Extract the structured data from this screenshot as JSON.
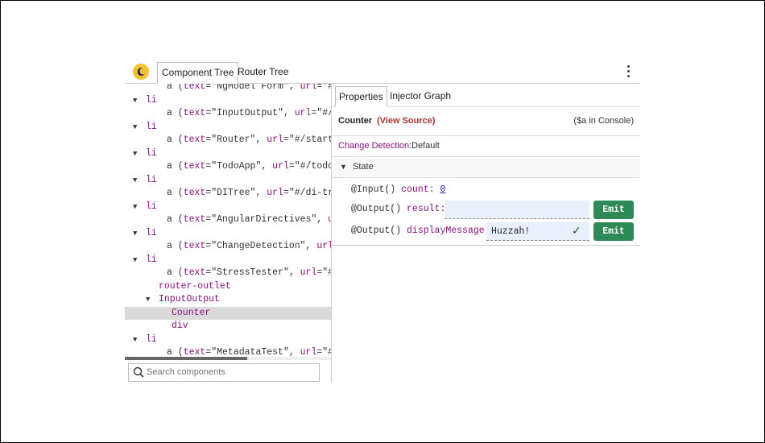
{
  "header": {
    "tabs": [
      "Component Tree",
      "Router Tree"
    ],
    "icons": {
      "logo": "angular-devtools-moon-icon",
      "menu": "kebab-menu-icon"
    },
    "accent_color": "#f5c22f"
  },
  "tree": {
    "rows": [
      {
        "tri": "",
        "parts": [
          [
            "txt",
            "a ("
          ],
          [
            "tag",
            "text"
          ],
          [
            "txt",
            "=\"NgModel Form\", "
          ],
          [
            "tag",
            "url"
          ],
          [
            "txt",
            "=\"#"
          ]
        ]
      },
      {
        "tri": "▼",
        "parts": [
          [
            "tag",
            "li"
          ]
        ]
      },
      {
        "tri": "",
        "parts": [
          [
            "txt",
            "a ("
          ],
          [
            "tag",
            "text"
          ],
          [
            "txt",
            "=\"InputOutput\", "
          ],
          [
            "tag",
            "url"
          ],
          [
            "txt",
            "=\"#/"
          ]
        ]
      },
      {
        "tri": "▼",
        "parts": [
          [
            "tag",
            "li"
          ]
        ]
      },
      {
        "tri": "",
        "parts": [
          [
            "txt",
            "a ("
          ],
          [
            "tag",
            "text"
          ],
          [
            "txt",
            "=\"Router\", "
          ],
          [
            "tag",
            "url"
          ],
          [
            "txt",
            "=\"#/start"
          ]
        ]
      },
      {
        "tri": "▼",
        "parts": [
          [
            "tag",
            "li"
          ]
        ]
      },
      {
        "tri": "",
        "parts": [
          [
            "txt",
            "a ("
          ],
          [
            "tag",
            "text"
          ],
          [
            "txt",
            "=\"TodoApp\", "
          ],
          [
            "tag",
            "url"
          ],
          [
            "txt",
            "=\"#/todo"
          ]
        ]
      },
      {
        "tri": "▼",
        "parts": [
          [
            "tag",
            "li"
          ]
        ]
      },
      {
        "tri": "",
        "parts": [
          [
            "txt",
            "a ("
          ],
          [
            "tag",
            "text"
          ],
          [
            "txt",
            "=\"DITree\", "
          ],
          [
            "tag",
            "url"
          ],
          [
            "txt",
            "=\"#/di-tr"
          ]
        ]
      },
      {
        "tri": "▼",
        "parts": [
          [
            "tag",
            "li"
          ]
        ]
      },
      {
        "tri": "",
        "parts": [
          [
            "txt",
            "a ("
          ],
          [
            "tag",
            "text"
          ],
          [
            "txt",
            "=\"AngularDirectives\", "
          ],
          [
            "tag",
            "u"
          ],
          [
            "txt",
            ""
          ]
        ]
      },
      {
        "tri": "▼",
        "parts": [
          [
            "tag",
            "li"
          ]
        ]
      },
      {
        "tri": "",
        "parts": [
          [
            "txt",
            "a ("
          ],
          [
            "tag",
            "text"
          ],
          [
            "txt",
            "=\"ChangeDetection\", "
          ],
          [
            "tag",
            "url"
          ],
          [
            "txt",
            ""
          ]
        ]
      },
      {
        "tri": "▼",
        "parts": [
          [
            "tag",
            "li"
          ]
        ]
      },
      {
        "tri": "",
        "parts": [
          [
            "txt",
            "a ("
          ],
          [
            "tag",
            "text"
          ],
          [
            "txt",
            "=\"StressTester\", "
          ],
          [
            "tag",
            "url"
          ],
          [
            "txt",
            "=\"#"
          ]
        ]
      },
      {
        "tri": "",
        "parts": [
          [
            "tag",
            "router-outlet"
          ]
        ]
      },
      {
        "tri": "▼",
        "parts": [
          [
            "tag",
            "InputOutput"
          ]
        ]
      },
      {
        "tri": "",
        "parts": [
          [
            "tag",
            "Counter"
          ]
        ]
      },
      {
        "tri": "",
        "parts": [
          [
            "tag",
            "div"
          ]
        ]
      },
      {
        "tri": "▼",
        "parts": [
          [
            "tag",
            "li"
          ]
        ]
      },
      {
        "tri": "",
        "parts": [
          [
            "txt",
            "a ("
          ],
          [
            "tag",
            "text"
          ],
          [
            "txt",
            "=\"MetadataTest\", "
          ],
          [
            "tag",
            "url"
          ],
          [
            "txt",
            "=\"#"
          ]
        ]
      }
    ]
  },
  "search": {
    "placeholder": "Search components",
    "icon": "search-icon"
  },
  "panel": {
    "tabs": [
      "Properties",
      "Injector Graph"
    ],
    "component_name": "Counter",
    "view_source": "(View Source)",
    "console_hint": "($a in Console)",
    "change_detection_label": "Change Detection:",
    "change_detection_value": "Default",
    "state_label": "State",
    "props": {
      "p1_decorator": "@Input()",
      "p1_name": "count:",
      "p1_value": "0",
      "p2_decorator": "@Output()",
      "p2_name": "result:",
      "p2_value": "",
      "p3_decorator": "@Output()",
      "p3_name": "displayMessage:",
      "p3_value": "Huzzah!",
      "check": "✓",
      "emit": "Emit"
    },
    "colors": {
      "emit_button": "#2e8b57",
      "view_source": "#aa3333",
      "property_name": "#881280"
    }
  }
}
